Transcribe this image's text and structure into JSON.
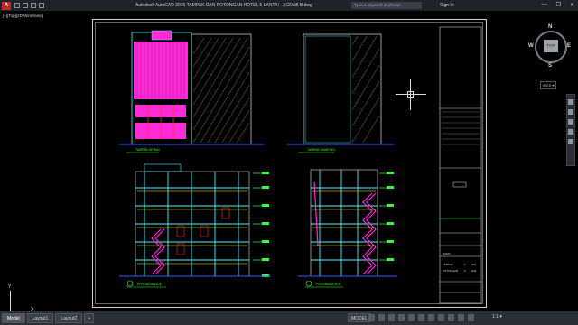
{
  "titlebar": {
    "app_logo": "A",
    "title": "Autodesk AutoCAD 2015    TAMPAK DAN POTONGAN HOTEL 5 LANTAI - AGDAB B.dwg",
    "search_placeholder": "Type a keyword or phrase",
    "signin": "Sign In",
    "minimize": "—",
    "restore": "❐",
    "close": "✕"
  },
  "viewport": {
    "label": "[−][Top][2D Wireframe]"
  },
  "drawings": {
    "front_elevation_caption": "TAMPAK DEPAN",
    "side_elevation_caption": "TAMPAK SAMPING",
    "section_a_caption": "POTONGAN A-A",
    "section_b_caption": "POTONGAN B-B"
  },
  "title_block": {
    "project_label": "NAMA",
    "rows": [
      {
        "name": "TAMPAK",
        "num": "1",
        "code": "A01"
      },
      {
        "name": "POTONGAN",
        "num": "2",
        "code": "A02"
      }
    ]
  },
  "viewcube": {
    "top_label": "TOP",
    "north": "N",
    "south": "S",
    "east": "E",
    "west": "W",
    "wcs": "WCS ▾"
  },
  "ucs": {
    "x": "X",
    "y": "Y"
  },
  "statusbar": {
    "tabs": [
      "Model",
      "Layout1",
      "Layout2"
    ],
    "add_tab": "+",
    "model_button": "MODEL",
    "scale": "1:1 ▾"
  },
  "colors": {
    "magenta": "#ff2bd6",
    "green": "#37ff37",
    "cyan": "#4bf2ff",
    "blue": "#2f5bff",
    "red": "#ff3030",
    "yellow": "#f2f230"
  }
}
